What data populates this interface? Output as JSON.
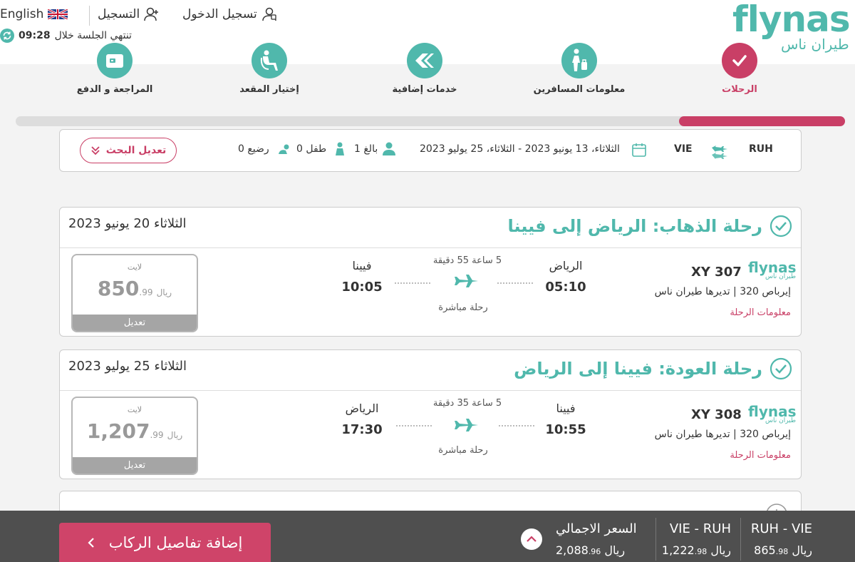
{
  "header": {
    "logo_text": "flynas",
    "logo_arabic": "طيران ناس",
    "login_label": "تسجيل الدخول",
    "register_label": "التسجيل",
    "language_label": "English",
    "session_label": "تنتهي الجلسة خلال",
    "session_time": "09:28"
  },
  "steps": [
    {
      "label": "الرحلات",
      "active": true
    },
    {
      "label": "معلومات المسافرين",
      "active": false
    },
    {
      "label": "خدمات إضافية",
      "active": false
    },
    {
      "label": "إختيار المقعد",
      "active": false
    },
    {
      "label": "المراجعة و الدفع",
      "active": false
    }
  ],
  "progress": {
    "fraction": 0.2
  },
  "search": {
    "origin": "RUH",
    "destination": "VIE",
    "dates": "الثلاثاء، 13 يونيو 2023 - الثلاثاء، 25 يوليو 2023",
    "adults": "1 بالغ",
    "children": "0 طفل",
    "infants": "0 رضيع",
    "modify_label": "تعديل البحث"
  },
  "flights": [
    {
      "title": "رحلة الذهاب: الرياض إلى فيينا",
      "date": "الثلاثاء 20 يونيو 2023",
      "brand": "flynas",
      "brand_sub": "طيران ناس",
      "flight_no": "XY 307",
      "aircraft": "إيرباص 320 | تديرها طيران ناس",
      "info_link": "معلومات الرحلة",
      "dep_city": "الرياض",
      "dep_time": "05:10",
      "arr_city": "فيينا",
      "arr_time": "10:05",
      "duration": "5 ساعة 55 دقيقة",
      "stops": "رحلة مباشرة",
      "fare_type": "لايت",
      "fare_main": "850",
      "fare_dec": ".99",
      "fare_currency": "ريال",
      "fare_edit": "تعديل"
    },
    {
      "title": "رحلة العودة: فيينا إلى الرياض",
      "date": "الثلاثاء 25 يوليو 2023",
      "brand": "flynas",
      "brand_sub": "طيران ناس",
      "flight_no": "XY 308",
      "aircraft": "إيرباص 320 | تديرها طيران ناس",
      "info_link": "معلومات الرحلة",
      "dep_city": "فيينا",
      "dep_time": "10:55",
      "arr_city": "الرياض",
      "arr_time": "17:30",
      "duration": "5 ساعة 35 دقيقة",
      "stops": "رحلة مباشرة",
      "fare_type": "لايت",
      "fare_main": "1,207",
      "fare_dec": ".99",
      "fare_currency": "ريال",
      "fare_edit": "تعديل"
    }
  ],
  "summary_bar": {
    "seg1_route": "RUH - VIE",
    "seg1_main": "865",
    "seg1_dec": ".98",
    "seg2_route": "VIE - RUH",
    "seg2_main": "1,222",
    "seg2_dec": ".98",
    "total_label": "السعر الاجمالي",
    "total_main": "2,088",
    "total_dec": ".96",
    "currency": "ريال",
    "cta_label": "إضافة تفاصيل الركاب"
  },
  "colors": {
    "teal": "#50b8ac",
    "brand_pink": "#c93f66",
    "bar": "#4f4f4f"
  }
}
